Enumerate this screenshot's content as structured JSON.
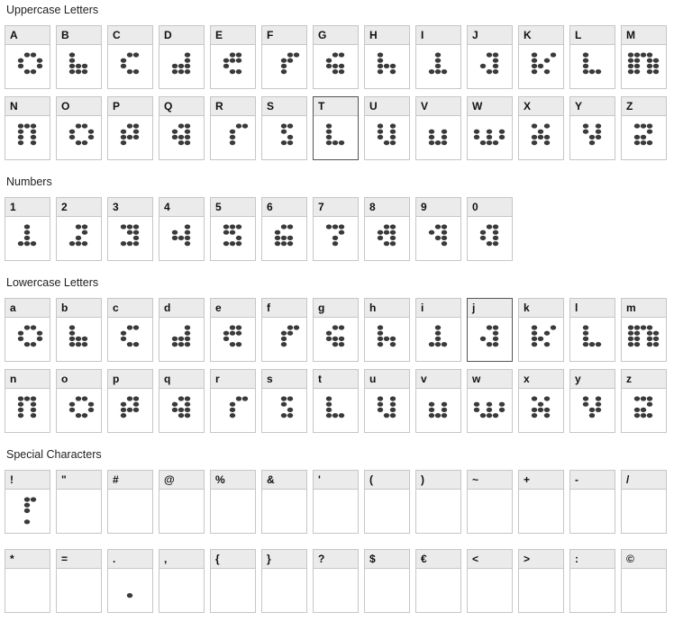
{
  "sections": [
    {
      "id": "uppercase",
      "title": "Uppercase Letters",
      "rows": [
        [
          {
            "label": "A",
            "glyph": [
              "00110",
              "01001",
              "01001",
              "00110",
              "00000"
            ]
          },
          {
            "label": "B",
            "glyph": [
              "01000",
              "01000",
              "01110",
              "01110",
              "00000"
            ]
          },
          {
            "label": "C",
            "glyph": [
              "00110",
              "01000",
              "01000",
              "00110",
              "00000"
            ]
          },
          {
            "label": "D",
            "glyph": [
              "00010",
              "00010",
              "01110",
              "01110",
              "00000"
            ]
          },
          {
            "label": "E",
            "glyph": [
              "00110",
              "01110",
              "01000",
              "00110",
              "00000"
            ]
          },
          {
            "label": "F",
            "glyph": [
              "00011",
              "00110",
              "00100",
              "00100",
              "00000"
            ]
          },
          {
            "label": "G",
            "glyph": [
              "00110",
              "01000",
              "01110",
              "00110",
              "00000"
            ]
          },
          {
            "label": "H",
            "glyph": [
              "01000",
              "01000",
              "01110",
              "01010",
              "00000"
            ]
          },
          {
            "label": "I",
            "glyph": [
              "00100",
              "00100",
              "00100",
              "01110",
              "00000"
            ]
          },
          {
            "label": "J",
            "glyph": [
              "00110",
              "00010",
              "01010",
              "00110",
              "00000"
            ]
          },
          {
            "label": "K",
            "glyph": [
              "01001",
              "01010",
              "01100",
              "01010",
              "00000"
            ]
          },
          {
            "label": "L",
            "glyph": [
              "01000",
              "01000",
              "01000",
              "01110",
              "00000"
            ]
          },
          {
            "label": "M",
            "glyph": [
              "11110",
              "11011",
              "11011",
              "11011",
              "00000"
            ]
          }
        ],
        [
          {
            "label": "N",
            "glyph": [
              "01110",
              "01010",
              "01010",
              "01010",
              "00000"
            ]
          },
          {
            "label": "O",
            "glyph": [
              "00110",
              "01001",
              "01001",
              "00110",
              "00000"
            ]
          },
          {
            "label": "P",
            "glyph": [
              "00110",
              "01010",
              "01110",
              "01000",
              "00000"
            ]
          },
          {
            "label": "Q",
            "glyph": [
              "00110",
              "01010",
              "01110",
              "00110",
              "00000"
            ]
          },
          {
            "label": "R",
            "glyph": [
              "00011",
              "00100",
              "00100",
              "00100",
              "00000"
            ]
          },
          {
            "label": "S",
            "glyph": [
              "00110",
              "00100",
              "00010",
              "00110",
              "00000"
            ]
          },
          {
            "label": "T",
            "glyph": [
              "01000",
              "01000",
              "01000",
              "01110",
              "00000"
            ],
            "selected": true
          },
          {
            "label": "U",
            "glyph": [
              "01010",
              "01010",
              "01010",
              "00110",
              "00000"
            ]
          },
          {
            "label": "V",
            "glyph": [
              "00000",
              "01010",
              "01010",
              "01110",
              "00000"
            ]
          },
          {
            "label": "W",
            "glyph": [
              "00000",
              "10101",
              "10101",
              "01110",
              "00000"
            ]
          },
          {
            "label": "X",
            "glyph": [
              "01010",
              "00100",
              "01110",
              "01010",
              "00000"
            ]
          },
          {
            "label": "Y",
            "glyph": [
              "01010",
              "01010",
              "00110",
              "00100",
              "00000"
            ]
          },
          {
            "label": "Z",
            "glyph": [
              "01110",
              "00010",
              "01100",
              "01110",
              "00000"
            ]
          }
        ]
      ]
    },
    {
      "id": "numbers",
      "title": "Numbers",
      "rows": [
        [
          {
            "label": "1",
            "glyph": [
              "00100",
              "00100",
              "00100",
              "01110",
              "00000"
            ]
          },
          {
            "label": "2",
            "glyph": [
              "00110",
              "00010",
              "00100",
              "01110",
              "00000"
            ]
          },
          {
            "label": "3",
            "glyph": [
              "01110",
              "00110",
              "00010",
              "01110",
              "00000"
            ]
          },
          {
            "label": "4",
            "glyph": [
              "00010",
              "01010",
              "01110",
              "00010",
              "00000"
            ]
          },
          {
            "label": "5",
            "glyph": [
              "01110",
              "01100",
              "00010",
              "01110",
              "00000"
            ]
          },
          {
            "label": "6",
            "glyph": [
              "00110",
              "01000",
              "01110",
              "01110",
              "00000"
            ]
          },
          {
            "label": "7",
            "glyph": [
              "01110",
              "00010",
              "00100",
              "00100",
              "00000"
            ]
          },
          {
            "label": "8",
            "glyph": [
              "00110",
              "01110",
              "01010",
              "00110",
              "00000"
            ]
          },
          {
            "label": "9",
            "glyph": [
              "00110",
              "01010",
              "00110",
              "00010",
              "00000"
            ]
          },
          {
            "label": "0",
            "glyph": [
              "00110",
              "01010",
              "01010",
              "00110",
              "00000"
            ]
          }
        ]
      ]
    },
    {
      "id": "lowercase",
      "title": "Lowercase Letters",
      "rows": [
        [
          {
            "label": "a",
            "glyph": [
              "00110",
              "01001",
              "01001",
              "00110",
              "00000"
            ]
          },
          {
            "label": "b",
            "glyph": [
              "01000",
              "01000",
              "01110",
              "01110",
              "00000"
            ]
          },
          {
            "label": "c",
            "glyph": [
              "00110",
              "01000",
              "01000",
              "00110",
              "00000"
            ]
          },
          {
            "label": "d",
            "glyph": [
              "00010",
              "00010",
              "01110",
              "01110",
              "00000"
            ]
          },
          {
            "label": "e",
            "glyph": [
              "00110",
              "01110",
              "01000",
              "00110",
              "00000"
            ]
          },
          {
            "label": "f",
            "glyph": [
              "00011",
              "00110",
              "00100",
              "00100",
              "00000"
            ]
          },
          {
            "label": "g",
            "glyph": [
              "00110",
              "01000",
              "01110",
              "00110",
              "00000"
            ]
          },
          {
            "label": "h",
            "glyph": [
              "01000",
              "01000",
              "01110",
              "01010",
              "00000"
            ]
          },
          {
            "label": "i",
            "glyph": [
              "00100",
              "00100",
              "00100",
              "01110",
              "00000"
            ]
          },
          {
            "label": "j",
            "glyph": [
              "00110",
              "00010",
              "01010",
              "00110",
              "00000"
            ],
            "selected": true
          },
          {
            "label": "k",
            "glyph": [
              "01001",
              "01010",
              "01100",
              "01010",
              "00000"
            ]
          },
          {
            "label": "l",
            "glyph": [
              "01000",
              "01000",
              "01000",
              "01110",
              "00000"
            ]
          },
          {
            "label": "m",
            "glyph": [
              "11110",
              "11011",
              "11011",
              "11011",
              "00000"
            ]
          }
        ],
        [
          {
            "label": "n",
            "glyph": [
              "01110",
              "01010",
              "01010",
              "01010",
              "00000"
            ]
          },
          {
            "label": "o",
            "glyph": [
              "00110",
              "01001",
              "01001",
              "00110",
              "00000"
            ]
          },
          {
            "label": "p",
            "glyph": [
              "00110",
              "01010",
              "01110",
              "01000",
              "00000"
            ]
          },
          {
            "label": "q",
            "glyph": [
              "00110",
              "01010",
              "01110",
              "00110",
              "00000"
            ]
          },
          {
            "label": "r",
            "glyph": [
              "00011",
              "00100",
              "00100",
              "00100",
              "00000"
            ]
          },
          {
            "label": "s",
            "glyph": [
              "00110",
              "00100",
              "00010",
              "00110",
              "00000"
            ]
          },
          {
            "label": "t",
            "glyph": [
              "01000",
              "01000",
              "01000",
              "01110",
              "00000"
            ]
          },
          {
            "label": "u",
            "glyph": [
              "01010",
              "01010",
              "01010",
              "00110",
              "00000"
            ]
          },
          {
            "label": "v",
            "glyph": [
              "00000",
              "01010",
              "01010",
              "01110",
              "00000"
            ]
          },
          {
            "label": "w",
            "glyph": [
              "00000",
              "10101",
              "10101",
              "01110",
              "00000"
            ]
          },
          {
            "label": "x",
            "glyph": [
              "01010",
              "00100",
              "01110",
              "01010",
              "00000"
            ]
          },
          {
            "label": "y",
            "glyph": [
              "01010",
              "01010",
              "00110",
              "00100",
              "00000"
            ]
          },
          {
            "label": "z",
            "glyph": [
              "01110",
              "00010",
              "01100",
              "01110",
              "00000"
            ]
          }
        ]
      ]
    },
    {
      "id": "special",
      "title": "Special Characters",
      "rows": [
        [
          {
            "label": "!",
            "glyph": [
              "00110",
              "00100",
              "00100",
              "00000",
              "00100"
            ]
          },
          {
            "label": "\"",
            "glyph": []
          },
          {
            "label": "#",
            "glyph": []
          },
          {
            "label": "@",
            "glyph": []
          },
          {
            "label": "%",
            "glyph": []
          },
          {
            "label": "&",
            "glyph": []
          },
          {
            "label": "'",
            "glyph": []
          },
          {
            "label": "(",
            "glyph": []
          },
          {
            "label": ")",
            "glyph": []
          },
          {
            "label": "~",
            "glyph": []
          },
          {
            "label": "+",
            "glyph": []
          },
          {
            "label": "-",
            "glyph": []
          },
          {
            "label": "/",
            "glyph": []
          }
        ],
        [
          {
            "label": "*",
            "glyph": []
          },
          {
            "label": "=",
            "glyph": []
          },
          {
            "label": ".",
            "glyph": [
              "00000",
              "00000",
              "00000",
              "00100",
              "00000"
            ]
          },
          {
            "label": ",",
            "glyph": []
          },
          {
            "label": "{",
            "glyph": []
          },
          {
            "label": "}",
            "glyph": []
          },
          {
            "label": "?",
            "glyph": []
          },
          {
            "label": "$",
            "glyph": []
          },
          {
            "label": "€",
            "glyph": []
          },
          {
            "label": "<",
            "glyph": []
          },
          {
            "label": ">",
            "glyph": []
          },
          {
            "label": ":",
            "glyph": []
          },
          {
            "label": "©",
            "glyph": []
          }
        ]
      ]
    }
  ],
  "colors": {
    "dot": "#3a3a3a",
    "label_bg": "#ebebeb",
    "border": "#c6c6c6",
    "selected_border": "#555555"
  }
}
